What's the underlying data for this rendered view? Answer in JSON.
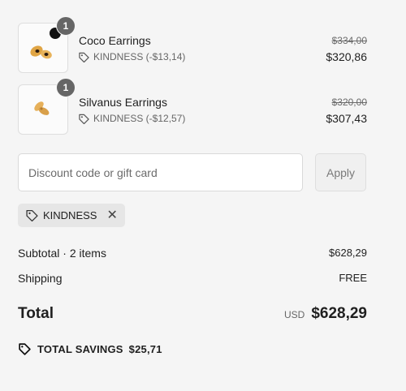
{
  "items": [
    {
      "quantity": "1",
      "name": "Coco Earrings",
      "discount": "KINDNESS (-$13,14)",
      "original_price": "$334,00",
      "price": "$320,86",
      "image_icon": "earrings-product-image"
    },
    {
      "quantity": "1",
      "name": "Silvanus Earrings",
      "discount": "KINDNESS (-$12,57)",
      "original_price": "$320,00",
      "price": "$307,43",
      "image_icon": "earrings-product-image"
    }
  ],
  "discount": {
    "placeholder": "Discount code or gift card",
    "value": "",
    "apply_label": "Apply",
    "applied_code": "KINDNESS",
    "remove_icon": "close-icon"
  },
  "summary": {
    "subtotal_label": "Subtotal · 2 items",
    "subtotal_value": "$628,29",
    "shipping_label": "Shipping",
    "shipping_value": "FREE",
    "total_label": "Total",
    "currency": "USD",
    "total_value": "$628,29",
    "savings_label": "TOTAL SAVINGS",
    "savings_value": "$25,71"
  },
  "colors": {
    "background": "#f5f5f5",
    "text": "#1f1f1f",
    "muted": "#666666",
    "badge": "#666666"
  }
}
